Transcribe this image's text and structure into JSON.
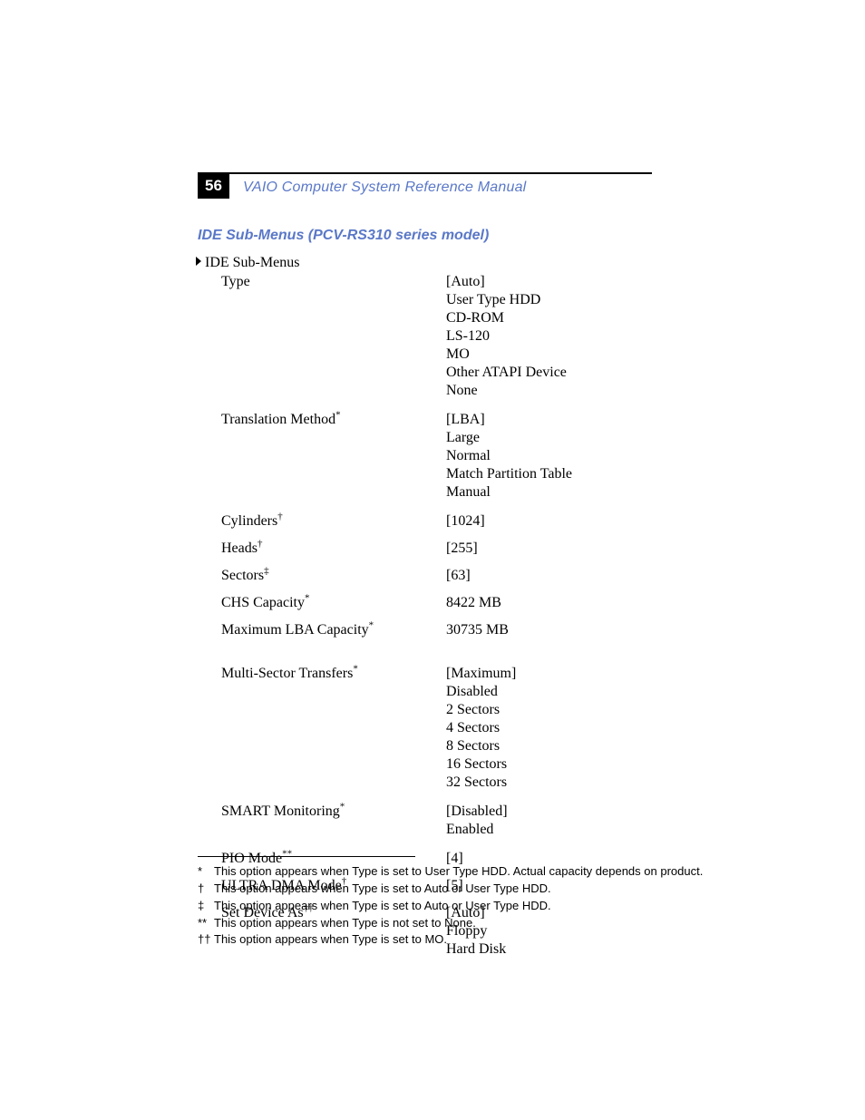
{
  "page_number": "56",
  "manual_title": "VAIO Computer System Reference Manual",
  "section_title": "IDE Sub-Menus (PCV-RS310 series model)",
  "submenu_header": "IDE Sub-Menus",
  "rows": {
    "type": {
      "label": "Type",
      "values": [
        "[Auto]",
        "User Type HDD",
        "CD-ROM",
        "LS-120",
        "MO",
        "Other ATAPI Device",
        "None"
      ]
    },
    "translation": {
      "label": "Translation Method",
      "sup": "*",
      "values": [
        "[LBA]",
        "Large",
        "Normal",
        "Match Partition Table",
        "Manual"
      ]
    },
    "cylinders": {
      "label": "Cylinders",
      "sup": "†",
      "values": [
        "[1024]"
      ]
    },
    "heads": {
      "label": "Heads",
      "sup": "†",
      "values": [
        "[255]"
      ]
    },
    "sectors": {
      "label": "Sectors",
      "sup": "‡",
      "values": [
        "[63]"
      ]
    },
    "chs": {
      "label": "CHS Capacity",
      "sup": "*",
      "values": [
        "8422 MB"
      ]
    },
    "maxlba": {
      "label": "Maximum LBA Capacity",
      "sup": "*",
      "values": [
        "30735 MB"
      ]
    },
    "multisector": {
      "label": "Multi-Sector Transfers",
      "sup": "*",
      "values": [
        "[Maximum]",
        "Disabled",
        "2 Sectors",
        "4 Sectors",
        "8 Sectors",
        "16 Sectors",
        "32 Sectors"
      ]
    },
    "smart": {
      "label": "SMART Monitoring",
      "sup": "*",
      "values": [
        "[Disabled]",
        "Enabled"
      ]
    },
    "pio": {
      "label": "PIO Mode",
      "sup": "**",
      "values": [
        "[4]"
      ]
    },
    "udma": {
      "label": "ULTRA DMA Mode",
      "sup": "†",
      "values": [
        "[5]"
      ]
    },
    "setdevice": {
      "label": "Set Device As",
      "sup": "††",
      "values": [
        "[Auto]",
        "Floppy",
        "Hard Disk"
      ]
    }
  },
  "footnotes": {
    "f1": {
      "mark": "*",
      "text": "This option appears when Type is set to User Type HDD. Actual capacity depends on product."
    },
    "f2": {
      "mark": "†",
      "text": "This option appears when Type is set to Auto or User Type HDD."
    },
    "f3": {
      "mark": "‡",
      "text": "This option appears when Type is set to Auto or User Type HDD."
    },
    "f4": {
      "mark": "**",
      "text": "This option appears when Type is not set to None."
    },
    "f5": {
      "mark": "††",
      "text": "This option appears when Type is set to MO."
    }
  }
}
